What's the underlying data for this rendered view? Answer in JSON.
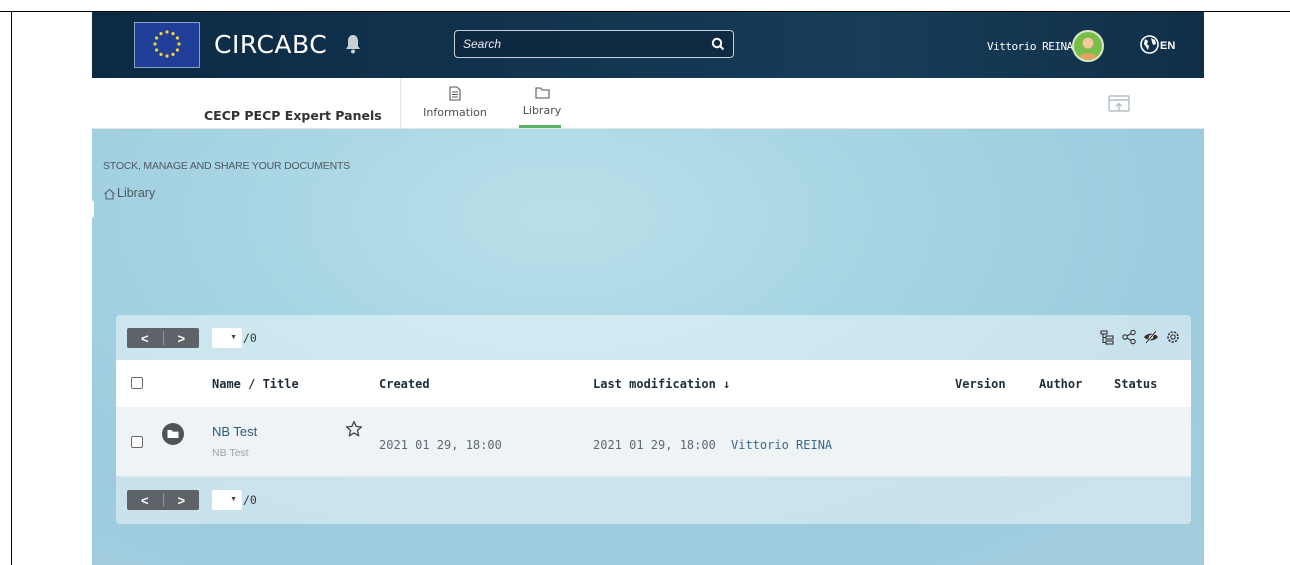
{
  "header": {
    "brand": "CIRCABC",
    "search_placeholder": "Search",
    "user_name": "Vittorio REINA",
    "language": "EN"
  },
  "subbar": {
    "group_name": "CECP PECP Expert Panels",
    "tabs": [
      {
        "label": "Information",
        "icon": "document-icon",
        "active": false
      },
      {
        "label": "Library",
        "icon": "folder-icon",
        "active": true
      }
    ]
  },
  "content": {
    "section_title": "STOCK, MANAGE AND SHARE YOUR DOCUMENTS",
    "breadcrumb": "Library"
  },
  "table": {
    "pager": {
      "prev": "<",
      "next": ">",
      "total": "/0"
    },
    "columns": {
      "name": "Name / Title",
      "created": "Created",
      "modified": "Last modification ↓",
      "version": "Version",
      "author": "Author",
      "status": "Status"
    },
    "rows": [
      {
        "name": "NB Test",
        "title": "NB Test",
        "created": "2021 01 29, 18:00",
        "modified": "2021 01 29, 18:00",
        "author": "Vittorio REINA"
      }
    ]
  },
  "colors": {
    "header_bg": "#12344f",
    "active_tab": "#5db26b",
    "pager_bg": "#5d6368",
    "link": "#3a6a8c"
  }
}
